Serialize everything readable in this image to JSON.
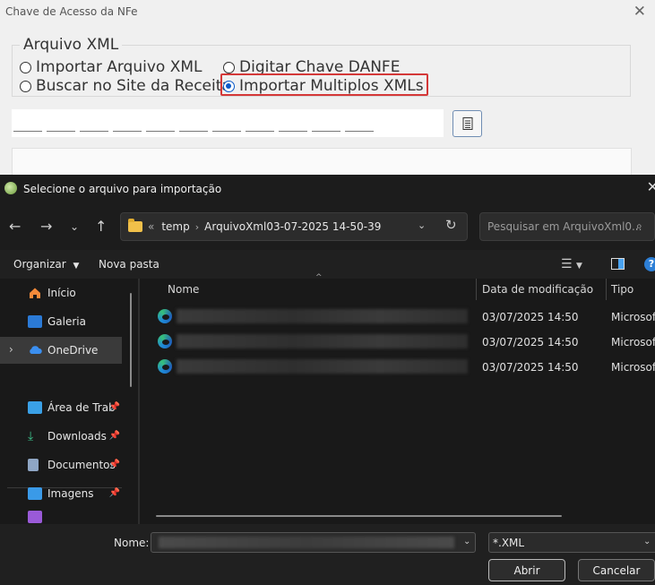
{
  "background_window": {
    "title": "Chave de Acesso da NFe",
    "group_label": "Arquivo XML",
    "radios": [
      {
        "label": "Importar Arquivo XML",
        "checked": false
      },
      {
        "label": "Digitar Chave DANFE",
        "checked": false
      },
      {
        "label": "Buscar no Site da Receita",
        "checked": false
      },
      {
        "label": "Importar Multiplos XMLs",
        "checked": true
      }
    ],
    "highlight_color": "#d43838"
  },
  "dialog": {
    "title": "Selecione o arquivo para importação",
    "address": {
      "overflow": "«",
      "segments": [
        "temp",
        "ArquivoXml03-07-2025 14-50-39"
      ]
    },
    "search_placeholder": "Pesquisar em ArquivoXml0...",
    "toolbar": {
      "organize": "Organizar",
      "new_folder": "Nova pasta",
      "help": "?"
    },
    "nav_items": [
      {
        "label": "Início",
        "icon": "home-icon",
        "pinned": false,
        "selected": false,
        "expandable": false
      },
      {
        "label": "Galeria",
        "icon": "gallery-icon",
        "pinned": false,
        "selected": false,
        "expandable": false
      },
      {
        "label": "OneDrive",
        "icon": "cloud-icon",
        "pinned": false,
        "selected": true,
        "expandable": true
      },
      {
        "label": "Área de Trab",
        "icon": "desktop-icon",
        "pinned": true,
        "selected": false,
        "expandable": false
      },
      {
        "label": "Downloads",
        "icon": "download-icon",
        "pinned": true,
        "selected": false,
        "expandable": false
      },
      {
        "label": "Documentos",
        "icon": "document-icon",
        "pinned": true,
        "selected": false,
        "expandable": false
      },
      {
        "label": "Imagens",
        "icon": "image-icon",
        "pinned": true,
        "selected": false,
        "expandable": false
      }
    ],
    "columns": {
      "name": "Nome",
      "modified": "Data de modificação",
      "type": "Tipo"
    },
    "files": [
      {
        "date": "03/07/2025 14:50",
        "type": "Microsoft"
      },
      {
        "date": "03/07/2025 14:50",
        "type": "Microsoft"
      },
      {
        "date": "03/07/2025 14:50",
        "type": "Microsoft"
      }
    ],
    "file_name_label": "Nome:",
    "file_type": "*.XML",
    "open_label": "Abrir",
    "cancel_label": "Cancelar"
  }
}
